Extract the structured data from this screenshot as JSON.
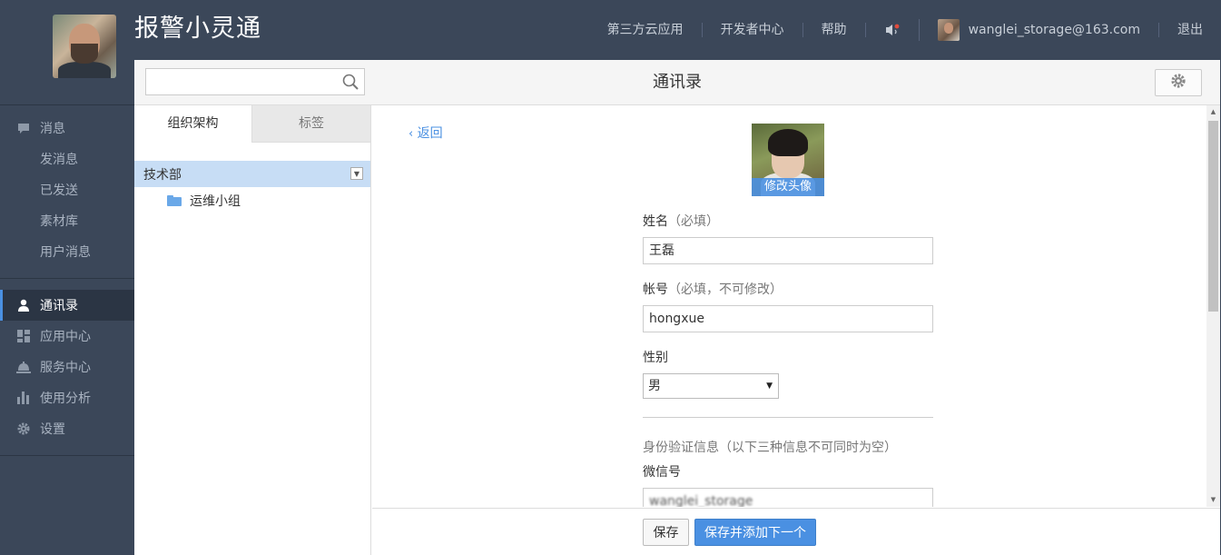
{
  "app": {
    "title": "报警小灵通"
  },
  "topnav": {
    "links": [
      "第三方云应用",
      "开发者中心",
      "帮助"
    ],
    "user_email": "wanglei_storage@163.com",
    "logout": "退出"
  },
  "sidebar": {
    "messages": {
      "label": "消息",
      "items": [
        "发消息",
        "已发送",
        "素材库",
        "用户消息"
      ]
    },
    "nav": [
      {
        "label": "通讯录",
        "icon": "contacts-icon",
        "active": true
      },
      {
        "label": "应用中心",
        "icon": "apps-icon"
      },
      {
        "label": "服务中心",
        "icon": "service-bell-icon"
      },
      {
        "label": "使用分析",
        "icon": "bar-chart-icon"
      },
      {
        "label": "设置",
        "icon": "gear-icon"
      }
    ]
  },
  "panel": {
    "title": "通讯录",
    "search": {
      "value": "",
      "placeholder": ""
    },
    "tabs": [
      {
        "label": "组织架构",
        "active": true
      },
      {
        "label": "标签",
        "active": false
      }
    ],
    "tree": {
      "department": "技术部",
      "subgroup": "运维小组"
    }
  },
  "form": {
    "back": "返回",
    "avatar_caption": "修改头像",
    "name": {
      "label": "姓名",
      "hint": "（必填）",
      "value": "王磊"
    },
    "account": {
      "label": "帐号",
      "hint": "（必填，不可修改）",
      "value": "hongxue"
    },
    "gender": {
      "label": "性别",
      "value": "男"
    },
    "identity_note": "身份验证信息（以下三种信息不可同时为空）",
    "wechat": {
      "label": "微信号",
      "value": "wanglei_storage"
    }
  },
  "footer": {
    "save": "保存",
    "save_next": "保存并添加下一个"
  },
  "colors": {
    "accent": "#4a90e2",
    "header_bg": "#3b4759",
    "selected_row": "#c7ddf5"
  }
}
